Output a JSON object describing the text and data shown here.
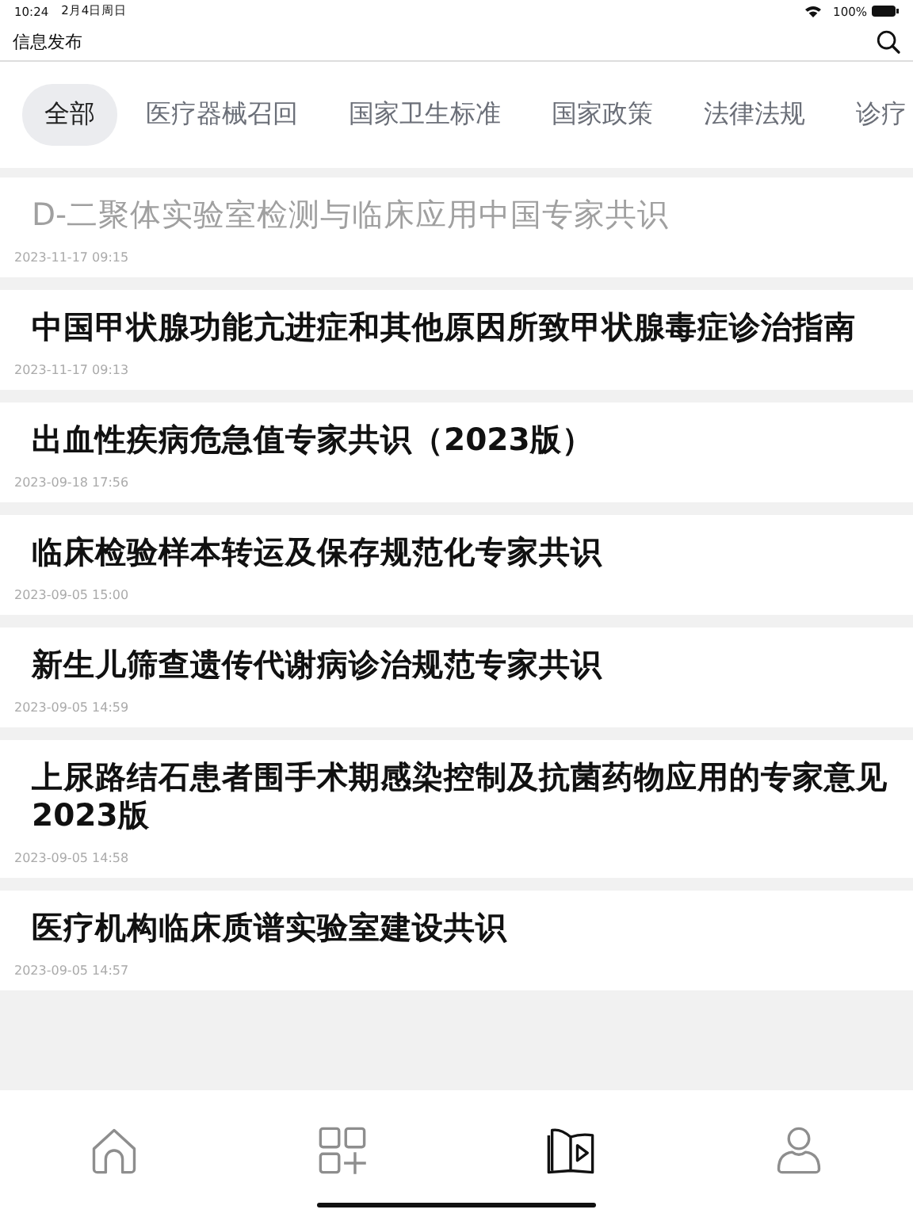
{
  "status_bar": {
    "time": "10:24",
    "date": "2月4日周日",
    "battery": "100%"
  },
  "header": {
    "title": "信息发布"
  },
  "tabs": [
    {
      "label": "全部",
      "selected": true
    },
    {
      "label": "医疗器械召回",
      "selected": false
    },
    {
      "label": "国家卫生标准",
      "selected": false
    },
    {
      "label": "国家政策",
      "selected": false
    },
    {
      "label": "法律法规",
      "selected": false
    },
    {
      "label": "诊疗",
      "selected": false
    }
  ],
  "articles": [
    {
      "title": "D-二聚体实验室检测与临床应用中国专家共识",
      "date": "2023-11-17 09:15",
      "read": true
    },
    {
      "title": "中国甲状腺功能亢进症和其他原因所致甲状腺毒症诊治指南",
      "date": "2023-11-17 09:13",
      "read": false
    },
    {
      "title": "出血性疾病危急值专家共识（2023版）",
      "date": "2023-09-18 17:56",
      "read": false
    },
    {
      "title": "临床检验样本转运及保存规范化专家共识",
      "date": "2023-09-05 15:00",
      "read": false
    },
    {
      "title": "新生儿筛查遗传代谢病诊治规范专家共识",
      "date": "2023-09-05 14:59",
      "read": false
    },
    {
      "title": "上尿路结石患者围手术期感染控制及抗菌药物应用的专家意见2023版",
      "date": "2023-09-05 14:58",
      "read": false
    },
    {
      "title": "医疗机构临床质谱实验室建设共识",
      "date": "2023-09-05 14:57",
      "read": false
    }
  ],
  "bottom_nav": [
    {
      "kind": "home",
      "selected": false
    },
    {
      "kind": "apps",
      "selected": false
    },
    {
      "kind": "library",
      "selected": true
    },
    {
      "kind": "profile",
      "selected": false
    }
  ]
}
